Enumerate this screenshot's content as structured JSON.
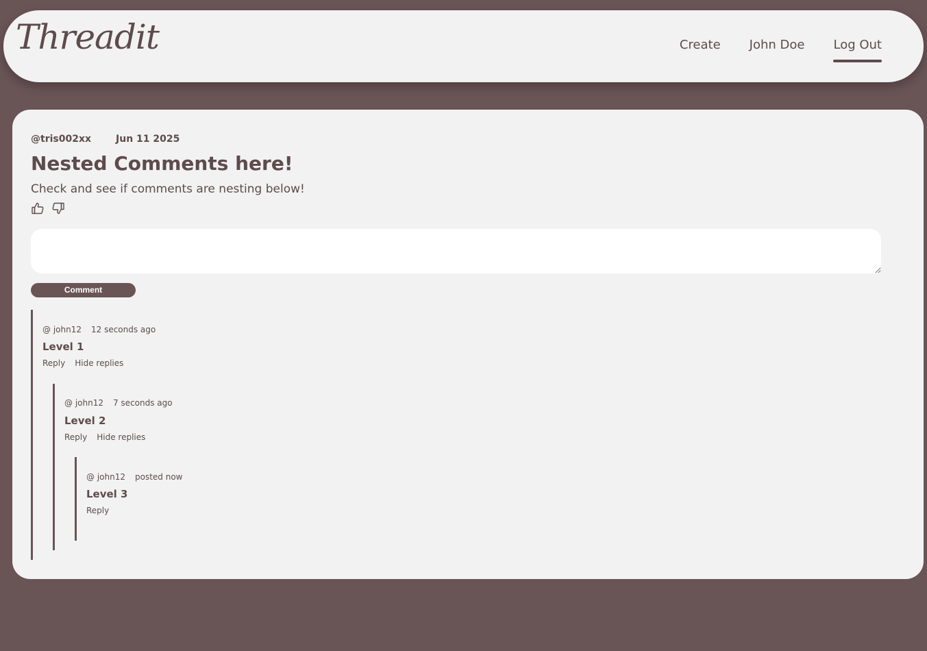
{
  "navbar": {
    "logo_text": "Threadit",
    "links": [
      {
        "label": "Create"
      },
      {
        "label": "John Doe"
      },
      {
        "label": "Log Out"
      }
    ]
  },
  "post": {
    "author": "@tris002xx",
    "date": "Jun 11 2025",
    "title": "Nested Comments here!",
    "body": "Check and see if comments are nesting below!",
    "like_icon": "thumbs-up-icon",
    "dislike_icon": "thumbs-down-icon"
  },
  "comment_form": {
    "placeholder": "",
    "button_label": "Comment"
  },
  "comments": [
    {
      "user": "@ john12",
      "time": "12 seconds ago",
      "text": "Level 1",
      "reply_label": "Reply",
      "hide_label": "Hide replies"
    },
    {
      "user": "@ john12",
      "time": "7 seconds ago",
      "text": "Level 2",
      "reply_label": "Reply",
      "hide_label": "Hide replies"
    },
    {
      "user": "@ john12",
      "time": "posted now",
      "text": "Level 3",
      "reply_label": "Reply"
    }
  ],
  "colors": {
    "background": "#695456",
    "card": "#f2f2f2",
    "text": "#5e4b4d",
    "accent": "#695456"
  }
}
